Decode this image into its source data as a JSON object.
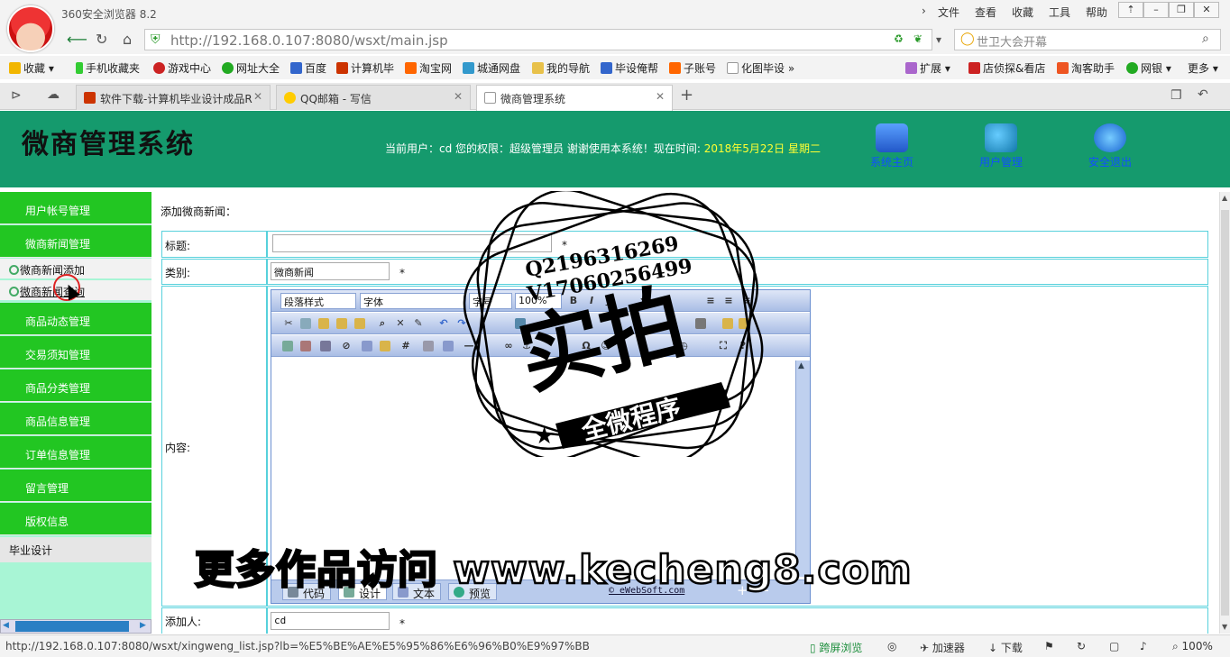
{
  "browser": {
    "app_title": "360安全浏览器 8.2",
    "menu": [
      "文件",
      "查看",
      "收藏",
      "工具",
      "帮助"
    ],
    "address": "http://192.168.0.107:8080/wsxt/main.jsp",
    "search_text": "世卫大会开幕",
    "bookmarks": [
      "收藏",
      "手机收藏夹",
      "游戏中心",
      "网址大全",
      "百度",
      "计算机毕",
      "淘宝网",
      "城通网盘",
      "我的导航",
      "毕设俺帮",
      "子账号",
      "化图毕设",
      "扩展",
      "店侦探&看店",
      "淘客助手",
      "网银",
      "更多"
    ],
    "tabs": [
      {
        "label": "软件下载-计算机毕业设计成品R",
        "active": false
      },
      {
        "label": "QQ邮箱 - 写信",
        "active": false
      },
      {
        "label": "微商管理系统",
        "active": true
      }
    ],
    "status_url": "http://192.168.0.107:8080/wsxt/xingweng_list.jsp?lb=%E5%BE%AE%E5%95%86%E6%96%B0%E9%97%BB",
    "status_items": [
      "跨屏浏览",
      "加速器",
      "下载",
      "100%"
    ]
  },
  "page": {
    "system_title": "微商管理系统",
    "user_info_prefix": "当前用户：cd 您的权限：超级管理员  谢谢使用本系统！现在时间:",
    "user_info_date": "2018年5月22日  星期二",
    "header_nav": [
      {
        "label": "系统主页",
        "icon": "home-icon"
      },
      {
        "label": "用户管理",
        "icon": "users-icon"
      },
      {
        "label": "安全退出",
        "icon": "logout-arrow-icon"
      }
    ]
  },
  "sidebar": {
    "items": [
      "用户帐号管理",
      "微商新闻管理",
      "商品动态管理",
      "交易须知管理",
      "商品分类管理",
      "商品信息管理",
      "订单信息管理",
      "留言管理",
      "版权信息"
    ],
    "subitems": [
      "微商新闻添加",
      "微商新闻查询"
    ],
    "footer": "毕业设计"
  },
  "form": {
    "heading": "添加微商新闻：",
    "title_label": "标题:",
    "title_value": "",
    "category_label": "类别:",
    "category_value": "微商新闻",
    "content_label": "内容:",
    "adder_label": "添加人:",
    "adder_value": "cd",
    "required_mark": "*"
  },
  "editor": {
    "paragraph_style": "段落样式",
    "font": "字体",
    "font_size": "字号",
    "zoom": "100%",
    "bottom_tabs": [
      "代码",
      "设计",
      "文本",
      "预览"
    ],
    "brand": "© eWebSoft.com"
  },
  "overlays": {
    "seal_qq": "Q2196316269",
    "seal_v": "V17060256499",
    "seal_main": "实拍",
    "seal_ribbon": "全微程序",
    "banner": "更多作品访问 www.kecheng8.com"
  }
}
